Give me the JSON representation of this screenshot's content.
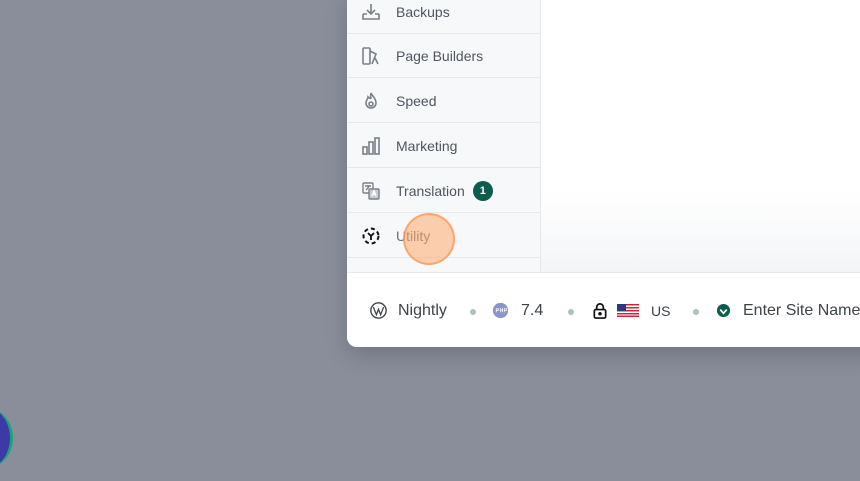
{
  "sidebar": {
    "items": [
      {
        "label": "Backups",
        "icon": "backup-download-icon"
      },
      {
        "label": "Page Builders",
        "icon": "page-builder-icon"
      },
      {
        "label": "Speed",
        "icon": "speed-flame-icon"
      },
      {
        "label": "Marketing",
        "icon": "bar-chart-icon"
      },
      {
        "label": "Translation",
        "icon": "translate-icon",
        "badge": "1"
      },
      {
        "label": "Utility",
        "icon": "utility-icon"
      }
    ]
  },
  "footer": {
    "wp_version": "Nightly",
    "php_version": "7.4",
    "region": "US",
    "site_name": "Enter Site Name"
  },
  "colors": {
    "accent": "#0d5c4e",
    "backdrop": "#8a8e9b"
  }
}
